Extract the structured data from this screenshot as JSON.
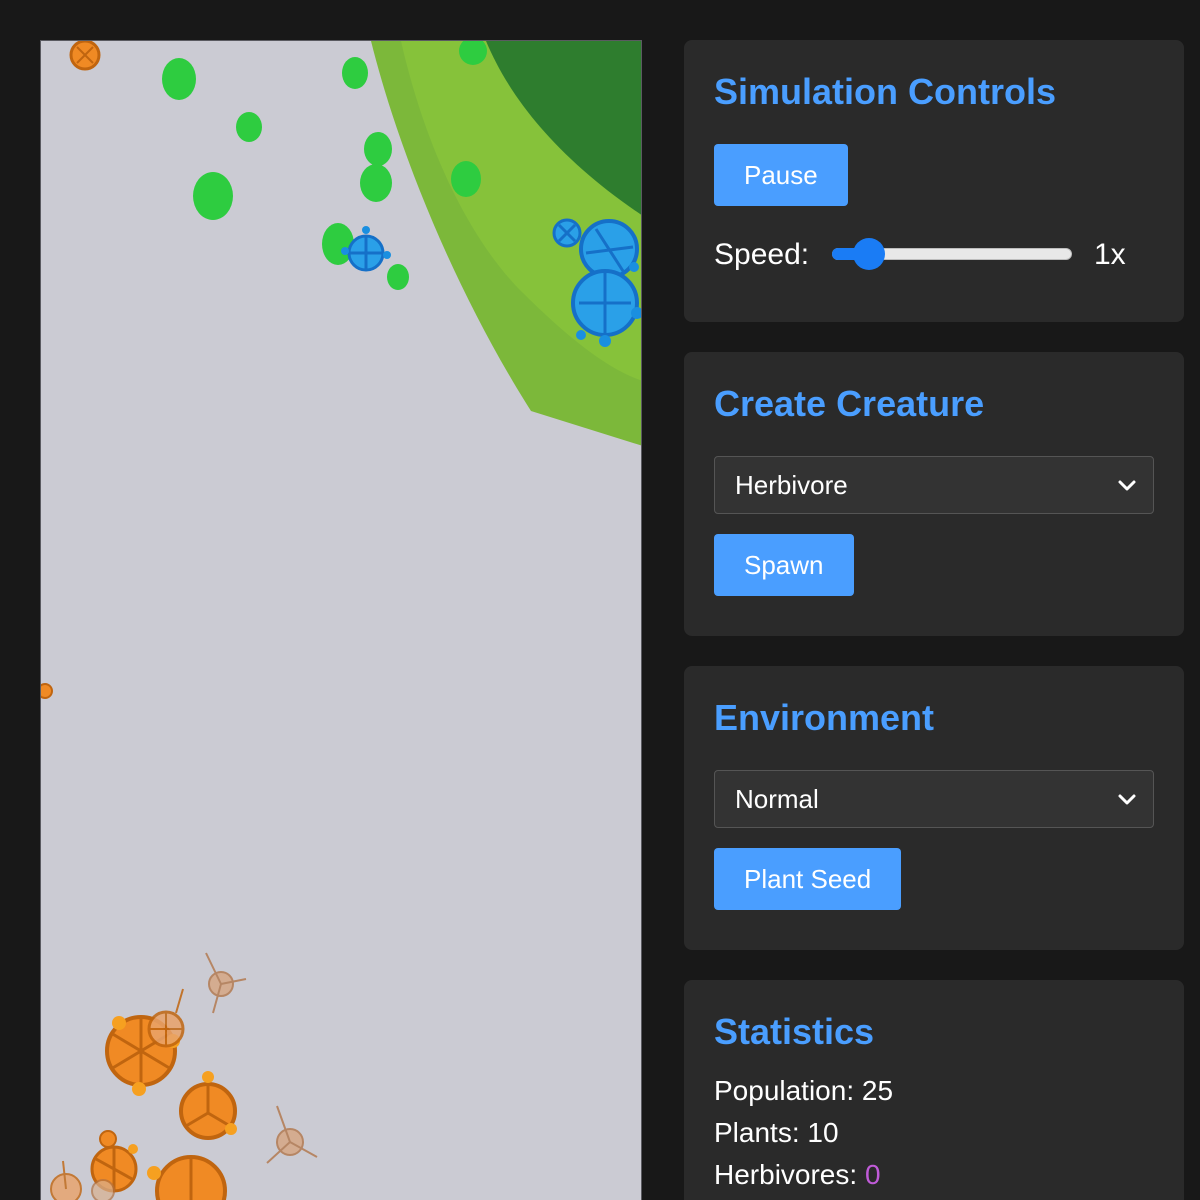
{
  "controls": {
    "title": "Simulation Controls",
    "pause_label": "Pause",
    "speed_label": "Speed:",
    "speed_value": "1x",
    "speed_fraction": 0.1
  },
  "create": {
    "title": "Create Creature",
    "selected_type": "Herbivore",
    "spawn_label": "Spawn"
  },
  "environment": {
    "title": "Environment",
    "selected_env": "Normal",
    "plant_label": "Plant Seed"
  },
  "statistics": {
    "title": "Statistics",
    "population_label": "Population:",
    "population_value": "25",
    "plants_label": "Plants:",
    "plants_value": "10",
    "herbivores_label": "Herbivores:",
    "herbivores_value": "0"
  },
  "colors": {
    "accent": "#4a9eff",
    "panel_bg": "#2a2a2a",
    "page_bg": "#181818",
    "canvas_bg": "#cbcbd3",
    "plant": "#2ecc40",
    "herbivore": "#1a8fe0",
    "carnivore": "#f08a24",
    "herbivore_count_color": "#c05bd8"
  }
}
